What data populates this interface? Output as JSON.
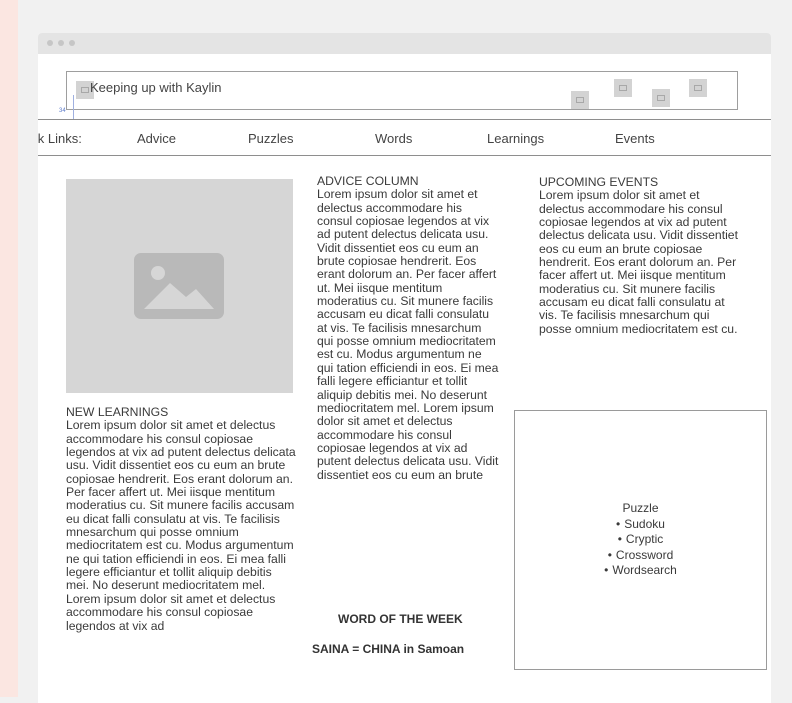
{
  "header": {
    "site_title": "Keeping up with Kaylin",
    "marker": "34"
  },
  "nav": {
    "label": "Quick Links:",
    "items": [
      "Advice",
      "Puzzles",
      "Words",
      "Learnings",
      "Events"
    ]
  },
  "image_placeholder": {
    "icon": "image-icon"
  },
  "new_learnings": {
    "title": "NEW LEARNINGS",
    "body": "Lorem ipsum dolor sit amet et delectus accommodare his consul copiosae legendos at vix ad putent delectus delicata usu. Vidit dissentiet eos cu eum an brute copiosae hendrerit. Eos erant dolorum an. Per facer affert ut. Mei iisque mentitum moderatius cu. Sit munere facilis accusam eu dicat falli consulatu at vis. Te facilisis mnesarchum qui posse omnium mediocritatem est cu. Modus argumentum ne qui tation efficiendi in eos. Ei mea falli legere efficiantur et tollit aliquip debitis mei. No deserunt mediocritatem mel. Lorem ipsum dolor sit amet et delectus accommodare his consul copiosae legendos at vix ad"
  },
  "advice_column": {
    "title": "ADVICE COLUMN",
    "body": "Lorem ipsum dolor sit amet et delectus accommodare his consul copiosae legendos at vix ad putent delectus delicata usu. Vidit dissentiet eos cu eum an brute copiosae hendrerit. Eos erant dolorum an. Per facer affert ut. Mei iisque mentitum moderatius cu. Sit munere facilis accusam eu dicat falli consulatu at vis. Te facilisis mnesarchum qui posse omnium mediocritatem est cu. Modus argumentum ne qui tation efficiendi in eos. Ei mea falli legere efficiantur et tollit aliquip debitis mei. No deserunt mediocritatem mel. Lorem ipsum dolor sit amet et delectus accommodare his consul copiosae legendos at vix ad putent delectus delicata usu. Vidit dissentiet eos cu eum an brute"
  },
  "word_of_the_week": {
    "title": "WORD OF THE WEEK",
    "body": "SAINA = CHINA in Samoan"
  },
  "upcoming_events": {
    "title": "UPCOMING EVENTS",
    "body": "Lorem ipsum dolor sit amet et delectus accommodare his consul copiosae legendos at vix ad putent delectus delicata usu. Vidit dissentiet eos cu eum an brute copiosae hendrerit. Eos erant dolorum an. Per facer affert ut. Mei iisque mentitum moderatius cu. Sit munere facilis accusam eu dicat falli consulatu at vis. Te facilisis mnesarchum qui posse omnium mediocritatem est cu."
  },
  "puzzle": {
    "title": "Puzzle",
    "items": [
      "Sudoku",
      "Cryptic",
      "Crossword",
      "Wordsearch"
    ]
  }
}
